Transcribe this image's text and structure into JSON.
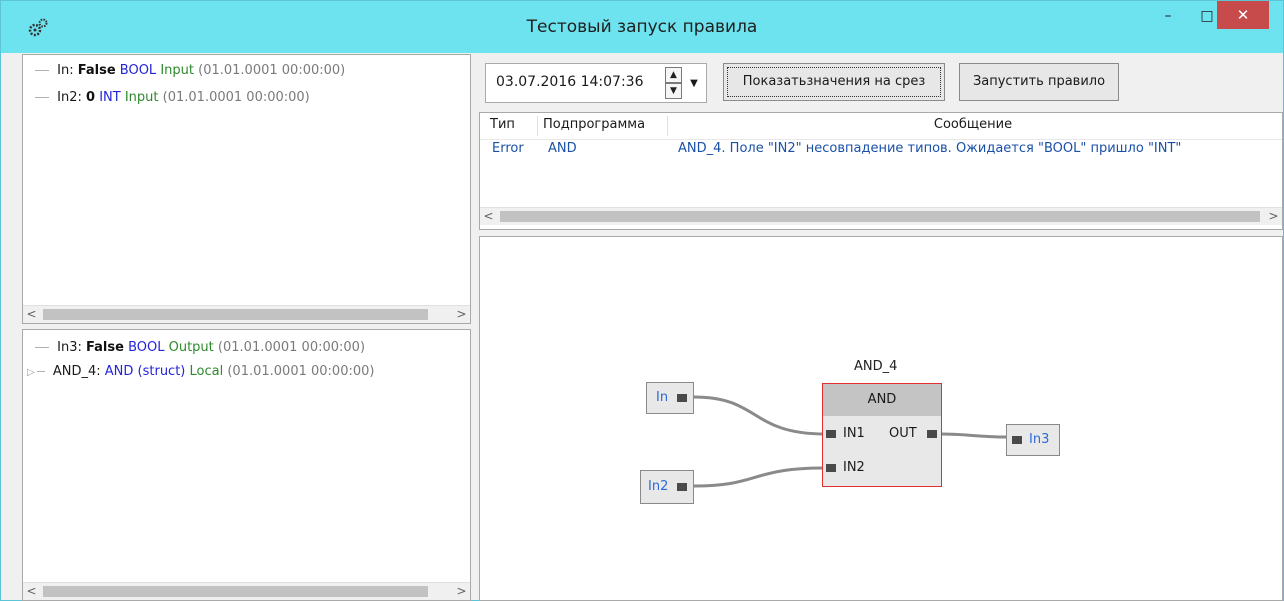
{
  "window": {
    "title": "Тестовый запуск правила",
    "controls": {
      "minimize": "–",
      "maximize": "□",
      "close": "✕"
    }
  },
  "inputs_tree": [
    {
      "name": "In:",
      "value": "False",
      "type": "BOOL",
      "kind": "Input",
      "time": "(01.01.0001 00:00:00)"
    },
    {
      "name": "In2:",
      "value": "0",
      "type": "INT",
      "kind": "Input",
      "time": "(01.01.0001 00:00:00)"
    }
  ],
  "outputs_tree": [
    {
      "name": "In3:",
      "value": "False",
      "type": "BOOL",
      "kind": "Output",
      "time": "(01.01.0001 00:00:00)"
    },
    {
      "name": "AND_4:",
      "value": "",
      "type": "AND (struct)",
      "kind": "Local",
      "time": "(01.01.0001 00:00:00)",
      "expandable": true
    }
  ],
  "toolbar": {
    "datetime": "03.07.2016 14:07:36",
    "show_values_button": "Показатьзначения на срез",
    "run_button": "Запустить правило"
  },
  "messages": {
    "columns": [
      "Тип",
      "Подпрограмма",
      "Сообщение"
    ],
    "rows": [
      {
        "type": "Error",
        "subprogram": "AND",
        "message": "AND_4. Поле \"IN2\" несовпадение типов. Ожидается \"BOOL\" пришло \"INT\""
      }
    ]
  },
  "diagram": {
    "block_title": "AND_4",
    "block_header": "AND",
    "ports": {
      "in1": "IN1",
      "in2": "IN2",
      "out": "OUT"
    },
    "nodes": {
      "in": "In",
      "in2": "In2",
      "in3": "In3"
    }
  },
  "colors": {
    "titlebar": "#6ce3ee",
    "close": "#c84b4b",
    "error_border": "#e03030",
    "link_blue": "#1a50a8"
  }
}
